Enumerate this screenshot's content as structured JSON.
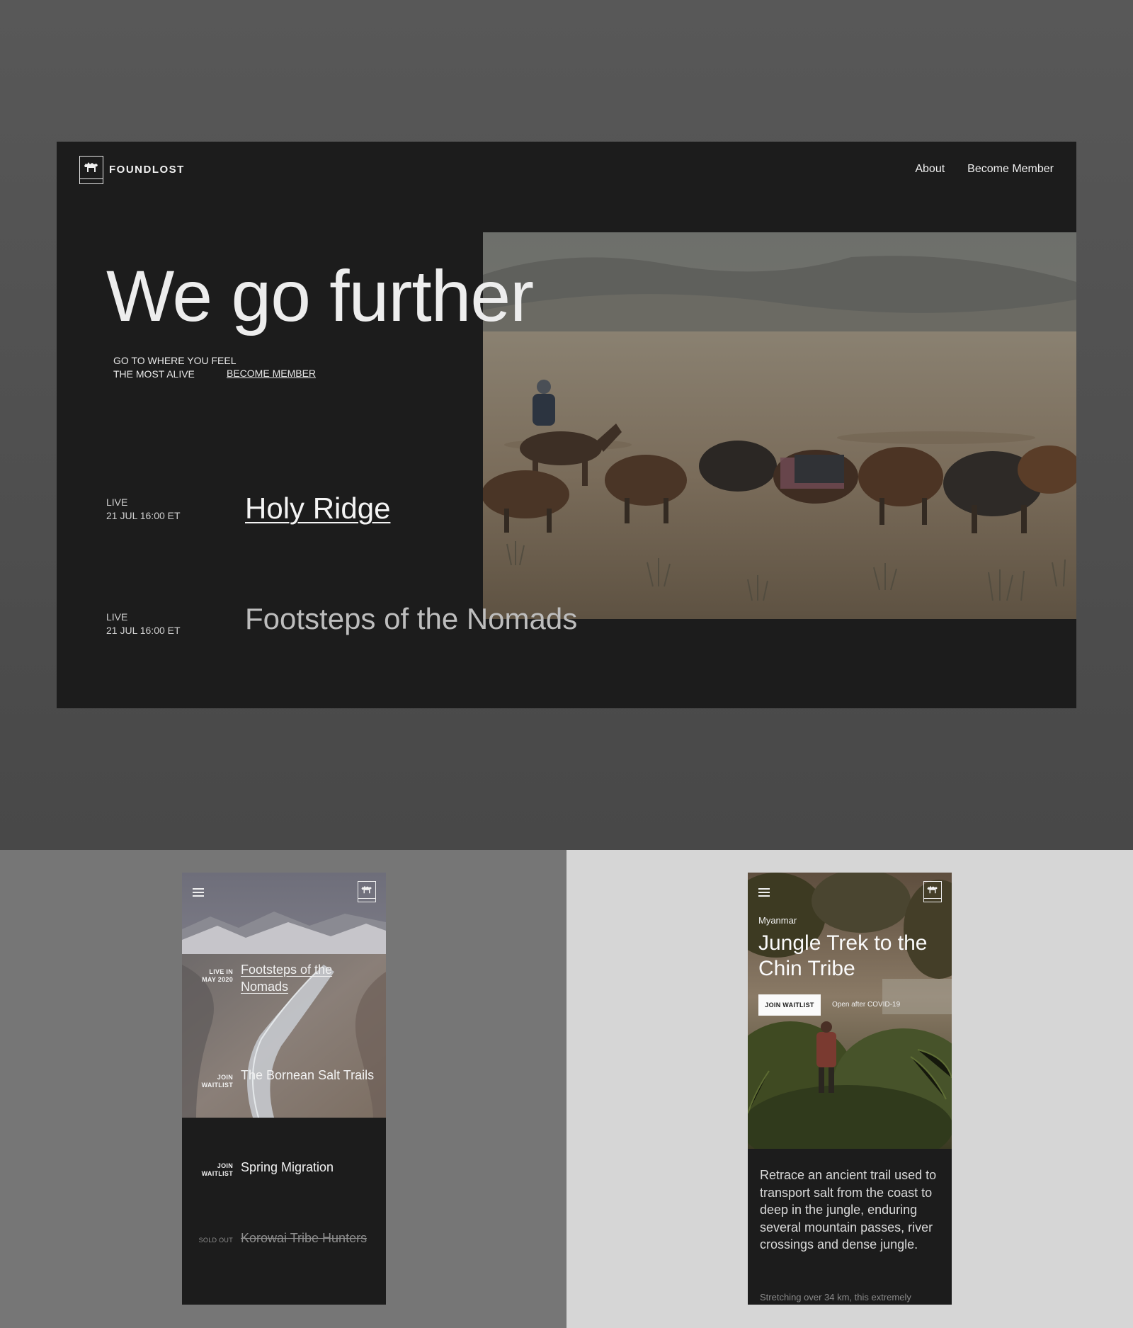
{
  "desktop": {
    "brand": "FOUNDLOST",
    "nav": [
      "About",
      "Become Member"
    ],
    "hero_title": "We go further",
    "tagline_line1": "GO TO WHERE YOU FEEL",
    "tagline_line2": "THE MOST ALIVE",
    "tagline_link": "BECOME MEMBER",
    "events": [
      {
        "status": "LIVE",
        "date": "21 JUL 16:00 ET",
        "title": "Holy Ridge"
      },
      {
        "status": "LIVE",
        "date": "21 JUL 16:00 ET",
        "title": "Footsteps of the Nomads"
      }
    ]
  },
  "mobile_list": {
    "items": [
      {
        "status_line1": "LIVE IN",
        "status_line2": "MAY 2020",
        "title": "Footsteps of the Nomads"
      },
      {
        "status_line1": "JOIN",
        "status_line2": "WAITLIST",
        "title": "The Bornean Salt Trails"
      },
      {
        "status_line1": "JOIN",
        "status_line2": "WAITLIST",
        "title": "Spring Migration"
      },
      {
        "status_line1": "SOLD OUT",
        "status_line2": "",
        "title": "Korowai Tribe Hunters"
      }
    ]
  },
  "mobile_detail": {
    "country": "Myanmar",
    "title": "Jungle Trek to the Chin Tribe",
    "button_label": "JOIN WAITLIST",
    "note": "Open after COVID-19",
    "description": "Retrace an ancient trail used to transport salt from the coast to deep in the jungle, enduring several mountain passes, river crossings and dense jungle.",
    "more_text": "Stretching over 34 km, this extremely"
  },
  "colors": {
    "panel_dark": "#1c1c1c",
    "text_light": "#ececec",
    "stage_top": "#505050",
    "stage_left": "#767676",
    "stage_right": "#d6d6d6"
  },
  "icons": [
    "camel-logo-icon",
    "hamburger-menu-icon"
  ]
}
